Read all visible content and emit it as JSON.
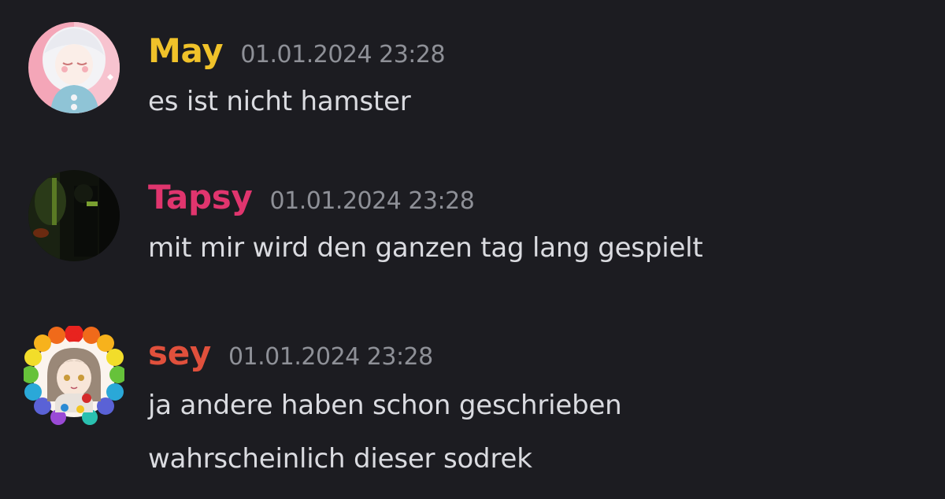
{
  "messages": [
    {
      "username": "May",
      "username_color": "#f0c22a",
      "timestamp": "01.01.2024 23:28",
      "lines": [
        "es ist nicht hamster"
      ],
      "avatar_icon": "anime-girl-avatar-icon"
    },
    {
      "username": "Tapsy",
      "username_color": "#e0356e",
      "timestamp": "01.01.2024 23:28",
      "lines": [
        "mit mir wird den ganzen tag lang gespielt"
      ],
      "avatar_icon": "dark-photo-avatar-icon"
    },
    {
      "username": "sey",
      "username_color": "#e0503c",
      "timestamp": "01.01.2024 23:28",
      "lines": [
        "ja andere haben schon geschrieben",
        "wahrscheinlich dieser sodrek"
      ],
      "avatar_icon": "rainbow-frame-avatar-icon"
    }
  ],
  "colors": {
    "background": "#1c1c21",
    "text": "#dadbe0",
    "timestamp": "#8e9097"
  }
}
